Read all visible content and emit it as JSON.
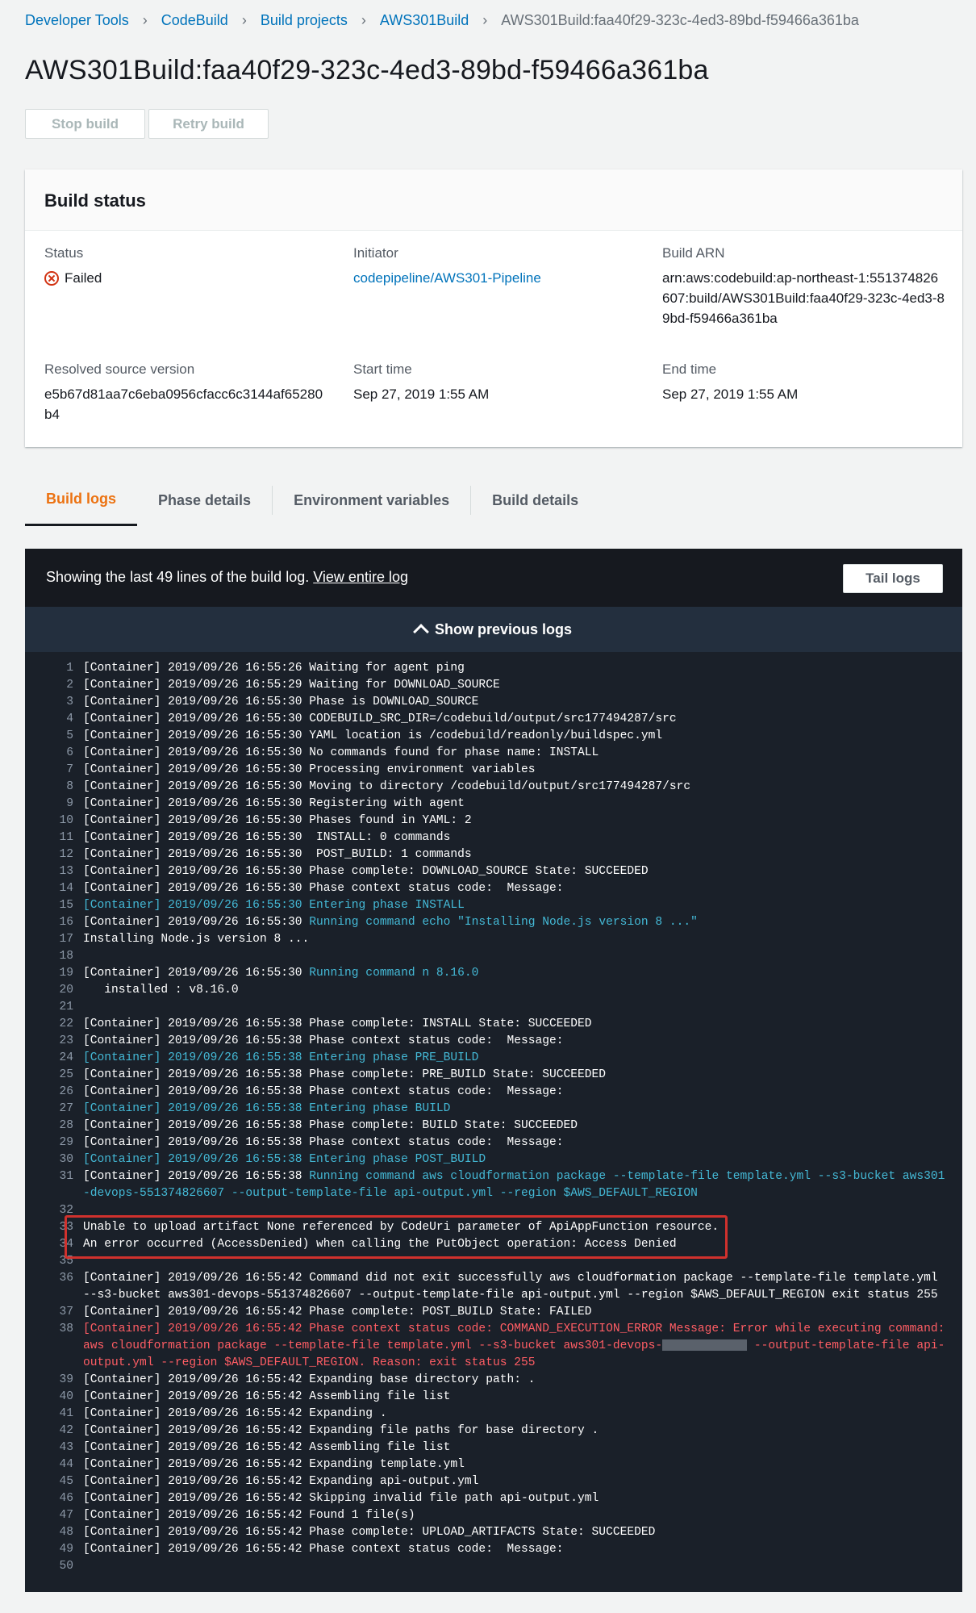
{
  "breadcrumb": [
    "Developer Tools",
    "CodeBuild",
    "Build projects",
    "AWS301Build",
    "AWS301Build:faa40f29-323c-4ed3-89bd-f59466a361ba"
  ],
  "page_title": "AWS301Build:faa40f29-323c-4ed3-89bd-f59466a361ba",
  "buttons": {
    "stop": "Stop build",
    "retry": "Retry build"
  },
  "build_status": {
    "heading": "Build status",
    "status_label": "Status",
    "status_value": "Failed",
    "initiator_label": "Initiator",
    "initiator_value": "codepipeline/AWS301-Pipeline",
    "arn_label": "Build ARN",
    "arn_value": "arn:aws:codebuild:ap-northeast-1:551374826607:build/AWS301Build:faa40f29-323c-4ed3-89bd-f59466a361ba",
    "source_label": "Resolved source version",
    "source_value": "e5b67d81aa7c6eba0956cfacc6c3144af65280b4",
    "start_label": "Start time",
    "start_value": "Sep 27, 2019 1:55 AM",
    "end_label": "End time",
    "end_value": "Sep 27, 2019 1:55 AM"
  },
  "tabs": [
    "Build logs",
    "Phase details",
    "Environment variables",
    "Build details"
  ],
  "logs": {
    "info_text": "Showing the last 49 lines of the build log.",
    "view_link": "View entire log",
    "tail_button": "Tail logs",
    "show_previous": "Show previous logs",
    "lines": [
      {
        "n": "1",
        "t": "[Container] 2019/09/26 16:55:26 Waiting for agent ping"
      },
      {
        "n": "2",
        "t": "[Container] 2019/09/26 16:55:29 Waiting for DOWNLOAD_SOURCE"
      },
      {
        "n": "3",
        "t": "[Container] 2019/09/26 16:55:30 Phase is DOWNLOAD_SOURCE"
      },
      {
        "n": "4",
        "t": "[Container] 2019/09/26 16:55:30 CODEBUILD_SRC_DIR=/codebuild/output/src177494287/src"
      },
      {
        "n": "5",
        "t": "[Container] 2019/09/26 16:55:30 YAML location is /codebuild/readonly/buildspec.yml"
      },
      {
        "n": "6",
        "t": "[Container] 2019/09/26 16:55:30 No commands found for phase name: INSTALL"
      },
      {
        "n": "7",
        "t": "[Container] 2019/09/26 16:55:30 Processing environment variables"
      },
      {
        "n": "8",
        "t": "[Container] 2019/09/26 16:55:30 Moving to directory /codebuild/output/src177494287/src"
      },
      {
        "n": "9",
        "t": "[Container] 2019/09/26 16:55:30 Registering with agent"
      },
      {
        "n": "10",
        "t": "[Container] 2019/09/26 16:55:30 Phases found in YAML: 2"
      },
      {
        "n": "11",
        "t": "[Container] 2019/09/26 16:55:30  INSTALL: 0 commands"
      },
      {
        "n": "12",
        "t": "[Container] 2019/09/26 16:55:30  POST_BUILD: 1 commands"
      },
      {
        "n": "13",
        "t": "[Container] 2019/09/26 16:55:30 Phase complete: DOWNLOAD_SOURCE State: SUCCEEDED"
      },
      {
        "n": "14",
        "t": "[Container] 2019/09/26 16:55:30 Phase context status code:  Message:"
      },
      {
        "n": "15",
        "t": "[Container] 2019/09/26 16:55:30 Entering phase INSTALL",
        "c": "blue"
      },
      {
        "n": "16",
        "p": "[Container] 2019/09/26 16:55:30 ",
        "t": "Running command echo \"Installing Node.js version 8 ...\"",
        "c": "blue"
      },
      {
        "n": "17",
        "t": "Installing Node.js version 8 ..."
      },
      {
        "n": "18",
        "t": ""
      },
      {
        "n": "19",
        "p": "[Container] 2019/09/26 16:55:30 ",
        "t": "Running command n 8.16.0",
        "c": "blue"
      },
      {
        "n": "20",
        "t": "   installed : v8.16.0"
      },
      {
        "n": "21",
        "t": ""
      },
      {
        "n": "22",
        "t": "[Container] 2019/09/26 16:55:38 Phase complete: INSTALL State: SUCCEEDED"
      },
      {
        "n": "23",
        "t": "[Container] 2019/09/26 16:55:38 Phase context status code:  Message:"
      },
      {
        "n": "24",
        "t": "[Container] 2019/09/26 16:55:38 Entering phase PRE_BUILD",
        "c": "blue"
      },
      {
        "n": "25",
        "t": "[Container] 2019/09/26 16:55:38 Phase complete: PRE_BUILD State: SUCCEEDED"
      },
      {
        "n": "26",
        "t": "[Container] 2019/09/26 16:55:38 Phase context status code:  Message:"
      },
      {
        "n": "27",
        "t": "[Container] 2019/09/26 16:55:38 Entering phase BUILD",
        "c": "blue"
      },
      {
        "n": "28",
        "t": "[Container] 2019/09/26 16:55:38 Phase complete: BUILD State: SUCCEEDED"
      },
      {
        "n": "29",
        "t": "[Container] 2019/09/26 16:55:38 Phase context status code:  Message:"
      },
      {
        "n": "30",
        "t": "[Container] 2019/09/26 16:55:38 Entering phase POST_BUILD",
        "c": "blue"
      },
      {
        "n": "31",
        "p": "[Container] 2019/09/26 16:55:38 ",
        "t": "Running command aws cloudformation package --template-file template.yml --s3-bucket aws301-devops-551374826607 --output-template-file api-output.yml --region $AWS_DEFAULT_REGION",
        "c": "blue"
      },
      {
        "n": "32",
        "t": ""
      },
      {
        "n": "33",
        "t": "Unable to upload artifact None referenced by CodeUri parameter of ApiAppFunction resource."
      },
      {
        "n": "34",
        "t": "An error occurred (AccessDenied) when calling the PutObject operation: Access Denied"
      },
      {
        "n": "35",
        "t": ""
      },
      {
        "n": "36",
        "t": "[Container] 2019/09/26 16:55:42 Command did not exit successfully aws cloudformation package --template-file template.yml --s3-bucket aws301-devops-551374826607 --output-template-file api-output.yml --region $AWS_DEFAULT_REGION exit status 255"
      },
      {
        "n": "37",
        "t": "[Container] 2019/09/26 16:55:42 Phase complete: POST_BUILD State: FAILED"
      },
      {
        "n": "38",
        "t": "[Container] 2019/09/26 16:55:42 Phase context status code: COMMAND_EXECUTION_ERROR Message: Error while executing command: aws cloudformation package --template-file template.yml --s3-bucket aws301-devops-",
        "t2": " --output-template-file api-output.yml --region $AWS_DEFAULT_REGION. Reason: exit status 255",
        "c": "red",
        "redact": true
      },
      {
        "n": "39",
        "t": "[Container] 2019/09/26 16:55:42 Expanding base directory path: ."
      },
      {
        "n": "40",
        "t": "[Container] 2019/09/26 16:55:42 Assembling file list"
      },
      {
        "n": "41",
        "t": "[Container] 2019/09/26 16:55:42 Expanding ."
      },
      {
        "n": "42",
        "t": "[Container] 2019/09/26 16:55:42 Expanding file paths for base directory ."
      },
      {
        "n": "43",
        "t": "[Container] 2019/09/26 16:55:42 Assembling file list"
      },
      {
        "n": "44",
        "t": "[Container] 2019/09/26 16:55:42 Expanding template.yml"
      },
      {
        "n": "45",
        "t": "[Container] 2019/09/26 16:55:42 Expanding api-output.yml"
      },
      {
        "n": "46",
        "t": "[Container] 2019/09/26 16:55:42 Skipping invalid file path api-output.yml"
      },
      {
        "n": "47",
        "t": "[Container] 2019/09/26 16:55:42 Found 1 file(s)"
      },
      {
        "n": "48",
        "t": "[Container] 2019/09/26 16:55:42 Phase complete: UPLOAD_ARTIFACTS State: SUCCEEDED"
      },
      {
        "n": "49",
        "t": "[Container] 2019/09/26 16:55:42 Phase context status code:  Message:"
      },
      {
        "n": "50",
        "t": ""
      }
    ]
  },
  "colors": {
    "link": "#0073bb",
    "failed": "#d13212",
    "active_tab": "#ec7211",
    "log_info": "#44b9d6",
    "log_error": "#ff5d64",
    "highlight_box": "#d0312d"
  }
}
